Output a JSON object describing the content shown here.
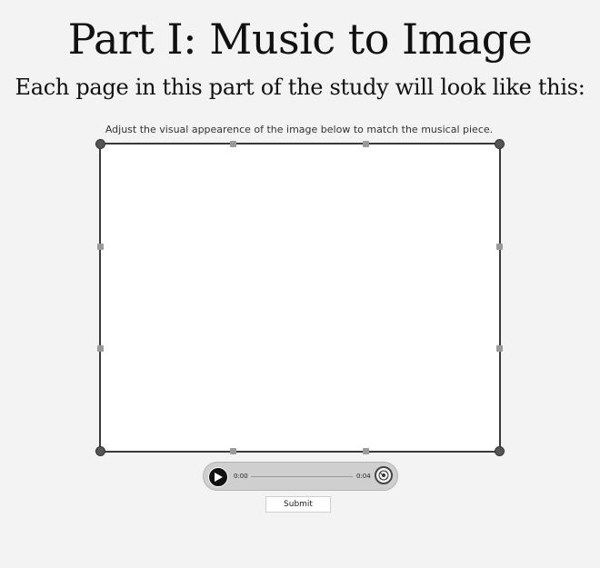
{
  "page": {
    "title": "Part I: Music to Image",
    "subtitle": "Each page in this part of the study will look like this:"
  },
  "task": {
    "instruction": "Adjust the visual appearence of the image below to match the musical piece."
  },
  "player": {
    "current_time": "0:00",
    "total_time": "0:04",
    "progress": 0,
    "play_icon": "play-icon",
    "extra_icon": "speaker-dial-icon"
  },
  "actions": {
    "submit_label": "Submit"
  },
  "colors": {
    "background": "#f3f3f3",
    "canvas_border": "#3a3a3a",
    "player_bg": "#cfcfcf"
  }
}
